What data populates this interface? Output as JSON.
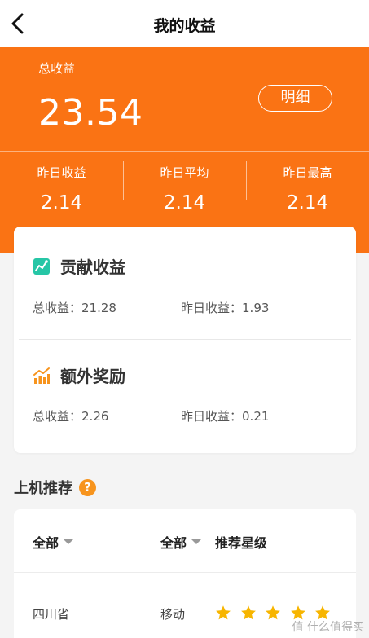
{
  "header": {
    "title": "我的收益",
    "back_icon": "chevron-left-icon"
  },
  "summary": {
    "total_label": "总收益",
    "total_value": "23.54",
    "detail_button": "明细",
    "stats": [
      {
        "label": "昨日收益",
        "value": "2.14"
      },
      {
        "label": "昨日平均",
        "value": "2.14"
      },
      {
        "label": "昨日最高",
        "value": "2.14"
      }
    ]
  },
  "earnings": {
    "contribution": {
      "title": "贡献收益",
      "icon": "chart-line-icon",
      "total_label": "总收益：",
      "total_value": "21.28",
      "yesterday_label": "昨日收益：",
      "yesterday_value": "1.93"
    },
    "bonus": {
      "title": "额外奖励",
      "icon": "bar-trend-icon",
      "total_label": "总收益：",
      "total_value": "2.26",
      "yesterday_label": "昨日收益：",
      "yesterday_value": "0.21"
    }
  },
  "recommend": {
    "title": "上机推荐",
    "help_icon": "question-icon",
    "help_glyph": "?",
    "filters": {
      "region": "全部",
      "operator": "全部",
      "rating_label": "推荐星级"
    },
    "rows": [
      {
        "region": "四川省",
        "operator": "移动",
        "stars": 5
      }
    ]
  },
  "watermark": "值 什么值得买",
  "colors": {
    "primary": "#fa7314",
    "teal": "#26c6a6",
    "star": "#f7b500"
  }
}
